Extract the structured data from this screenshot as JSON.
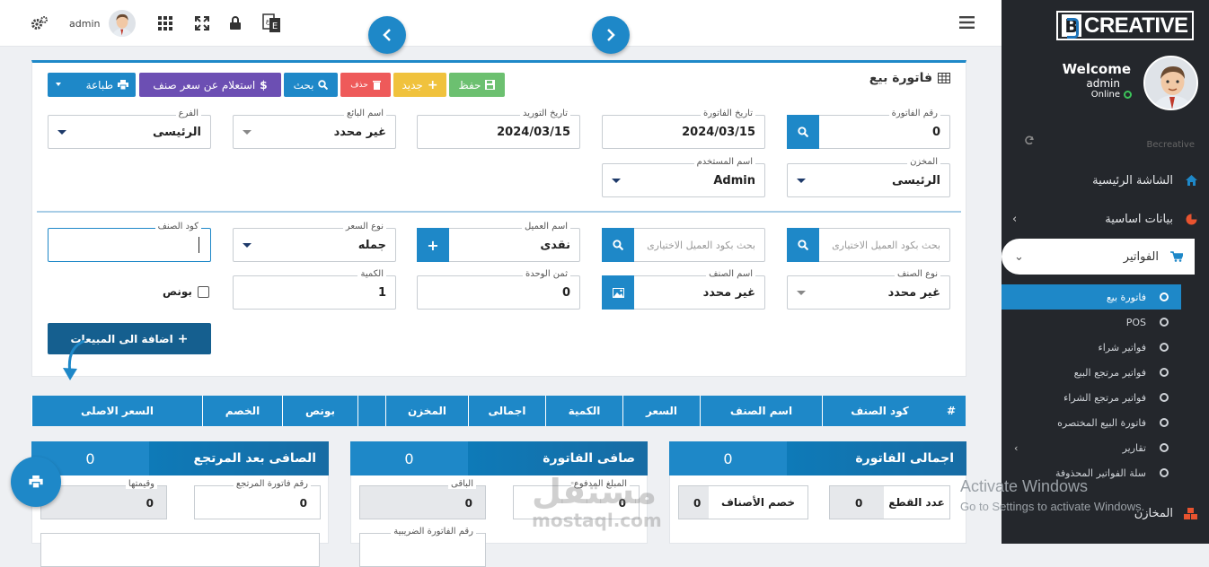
{
  "topbar": {
    "user": "admin"
  },
  "sidebar": {
    "logo": "CREATIVE",
    "welcome": "Welcome",
    "user": "admin",
    "status": "Online",
    "brand": "Becreative",
    "nav": [
      {
        "label": "الشاشة الرئيسية",
        "icon": "home-icon"
      },
      {
        "label": "بيانات اساسية",
        "icon": "pie-chart-icon"
      },
      {
        "label": "الفواتير",
        "icon": "cart-icon"
      }
    ],
    "sub": [
      {
        "label": "فاتورة بيع"
      },
      {
        "label": "POS"
      },
      {
        "label": "فواتير شراء"
      },
      {
        "label": "فواتير مرتجع البيع"
      },
      {
        "label": "فواتير مرتجع الشراء"
      },
      {
        "label": "فاتورة البيع المختصره"
      },
      {
        "label": "تقارير"
      },
      {
        "label": "سلة الفواتير المحذوفة"
      }
    ],
    "next_section": "المخازن"
  },
  "invoice": {
    "title": "فاتورة بيع",
    "buttons": {
      "save": "حفظ",
      "new": "جديد",
      "delete": "حذف",
      "search": "بحث",
      "price_query": "استعلام عن سعر صنف",
      "print": "طباعة"
    },
    "fields": {
      "invoice_no": {
        "label": "رقم الفاتورة",
        "value": "0"
      },
      "invoice_date": {
        "label": "تاريخ الفاتورة",
        "value": "2024/03/15"
      },
      "supply_date": {
        "label": "تاريخ التوريد",
        "value": "2024/03/15"
      },
      "seller": {
        "label": "اسم البائع",
        "value": "غير محدد"
      },
      "branch": {
        "label": "الفرع",
        "value": "الرئيسى"
      },
      "store": {
        "label": "المخزن",
        "value": "الرئيسى"
      },
      "user": {
        "label": "اسم المستخدم",
        "value": "Admin"
      }
    }
  },
  "items": {
    "search1": "بحث بكود العميل الاختيارى",
    "search2": "بحث بكود العميل الاختيارى",
    "customer": {
      "label": "اسم العميل",
      "value": "نقدى"
    },
    "price_type": {
      "label": "نوع السعر",
      "value": "جمله"
    },
    "item_code": {
      "label": "كود الصنف",
      "value": ""
    },
    "item_type": {
      "label": "نوع الصنف",
      "value": "غير محدد"
    },
    "item_name": {
      "label": "اسم الصنف",
      "value": "غير محدد"
    },
    "unit_price": {
      "label": "ثمن الوحدة",
      "value": "0"
    },
    "qty": {
      "label": "الكمية",
      "value": "1"
    },
    "bonus": "بونص",
    "add_button": "اضافة الى المبيعات"
  },
  "table": {
    "headers": [
      "#",
      "كود الصنف",
      "اسم الصنف",
      "السعر",
      "الكمية",
      "اجمالى",
      "المخزن",
      "",
      "بونص",
      "الخصم",
      "السعر الاصلى"
    ]
  },
  "totals": {
    "total": {
      "label": "اجمالى الفاتورة",
      "value": "0"
    },
    "net": {
      "label": "صافى الفاتورة",
      "value": "0"
    },
    "net_after_return": {
      "label": "الصافى بعد المرتجع",
      "value": "0"
    },
    "pieces": {
      "label": "عدد القطع",
      "value": "0"
    },
    "item_discount": {
      "label": "خصم الأصناف",
      "value": "0"
    },
    "paid": {
      "label": "المبلغ المدفوع",
      "value": "0"
    },
    "remaining": {
      "label": "الباقى",
      "value": "0"
    },
    "return_no": {
      "label": "رقم فاتورة المرتجع",
      "value": "0"
    },
    "return_value": {
      "label": "وقيمتها",
      "value": "0"
    },
    "tax_no": {
      "label": "رقم الفاتورة الضريبية"
    }
  },
  "overlay": {
    "watermark1": "مستقل",
    "watermark2": "mostaql.com",
    "activate_title": "Activate Windows",
    "activate_sub": "Go to Settings to activate Windows."
  }
}
